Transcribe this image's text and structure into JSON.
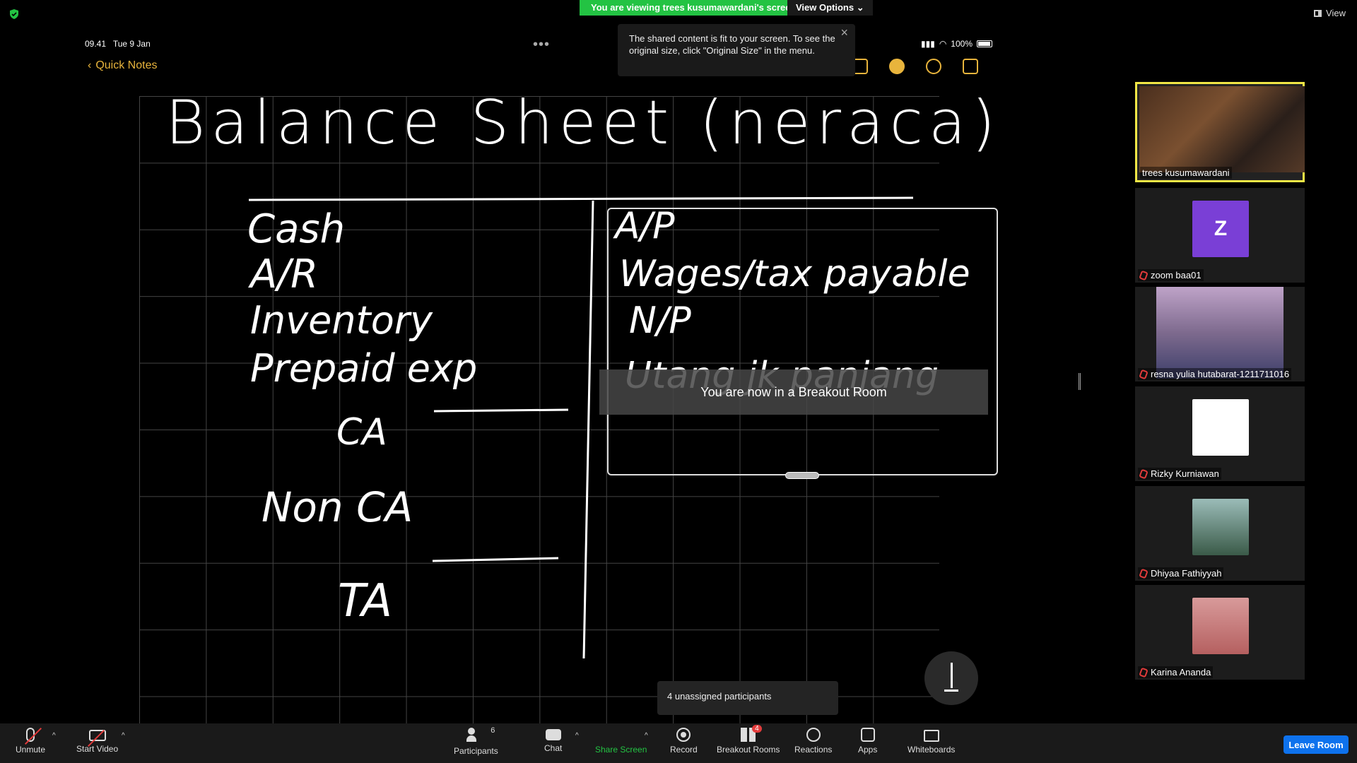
{
  "banner": {
    "viewing": "You are viewing trees kusumawardani's screen",
    "view_options": "View Options ⌄",
    "view_right": "View"
  },
  "shared": {
    "time": "09.41",
    "date": "Tue 9 Jan",
    "battery": "100%",
    "back_label": "Quick Notes",
    "title": "Balance Sheet (neraca)",
    "left_items": [
      "Cash",
      "A/R",
      "Inventory",
      "Prepaid exp",
      "CA",
      "Non CA",
      "TA"
    ],
    "right_items": [
      "A/P",
      "Wages/tax payable",
      "N/P",
      "Utang jk panjang"
    ]
  },
  "tooltip": {
    "text": "The shared content is fit to your screen. To see the original size, click \"Original Size\" in the menu."
  },
  "toast": "You are now in a Breakout Room",
  "unassigned": "4 unassigned participants",
  "participants": [
    {
      "name": "trees kusumawardani"
    },
    {
      "name": "zoom baa01",
      "initial": "Z"
    },
    {
      "name": "resna yulia hutabarat-1211711016"
    },
    {
      "name": "Rizky Kurniawan"
    },
    {
      "name": "Dhiyaa Fathiyyah"
    },
    {
      "name": "Karina Ananda"
    }
  ],
  "toolbar": {
    "unmute": "Unmute",
    "start_video": "Start Video",
    "participants": "Participants",
    "participants_count": "6",
    "chat": "Chat",
    "share_screen": "Share Screen",
    "record": "Record",
    "breakout_rooms": "Breakout Rooms",
    "breakout_badge": "4",
    "reactions": "Reactions",
    "apps": "Apps",
    "whiteboards": "Whiteboards",
    "leave": "Leave Room"
  },
  "colors": {
    "share_green": "#23c343",
    "leave_blue": "#0e72ed",
    "ios_accent": "#e8b43c",
    "active_speaker": "#f0e646"
  }
}
